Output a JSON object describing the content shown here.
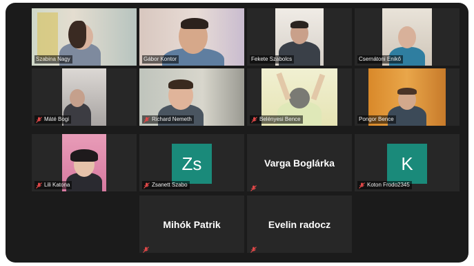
{
  "meeting": {
    "participants": [
      {
        "name": "Szabina Nagy",
        "kind": "video",
        "muted": false
      },
      {
        "name": "Gábor Kontor",
        "kind": "video",
        "muted": false,
        "active_speaker": true
      },
      {
        "name": "Fekete Szabolcs",
        "kind": "video",
        "muted": false
      },
      {
        "name": "Csernátoni Enikő",
        "kind": "video",
        "muted": false
      },
      {
        "name": "Máté Bogi",
        "kind": "video",
        "muted": true
      },
      {
        "name": "Richard Nemeth",
        "kind": "video",
        "muted": true
      },
      {
        "name": "Belényesi Bence",
        "kind": "video",
        "muted": true
      },
      {
        "name": "Pongor Bence",
        "kind": "video",
        "muted": false
      },
      {
        "name": "Lili Katona",
        "kind": "video",
        "muted": true
      },
      {
        "name": "Zsanett Szabo",
        "kind": "avatar",
        "initials": "Zs",
        "muted": true
      },
      {
        "name": "Varga Boglárka",
        "kind": "name-only",
        "muted": true
      },
      {
        "name": "Koton Frodo2345",
        "kind": "avatar",
        "initials": "K",
        "muted": true
      },
      {
        "name": "Mihók Patrik",
        "kind": "name-only",
        "muted": true
      },
      {
        "name": "Evelin radocz",
        "kind": "name-only",
        "muted": true
      }
    ]
  },
  "colors": {
    "background": "#1b1b1b",
    "tile": "#272727",
    "avatar": "#1a8a7a",
    "active_border": "#d8d23c",
    "mute_icon": "#e04848"
  }
}
